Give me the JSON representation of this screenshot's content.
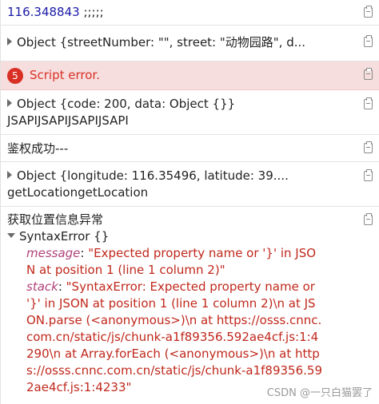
{
  "rows": {
    "r1": {
      "value": "116.348843",
      "suffix": " ;;;;;"
    },
    "r2": {
      "text": "Object {streetNumber: \"\", street: \"动物园路\", d..."
    },
    "r3": {
      "badge": "5",
      "text": "Script error."
    },
    "r4": {
      "line1": "Object {code: 200, data: Object {}}",
      "line2": "JSAPIJSAPIJSAPIJSAPI"
    },
    "r5": {
      "text": "鉴权成功---"
    },
    "r6": {
      "line1": "Object {longitude: 116.35496, latitude: 39....",
      "line2": "getLocationgetLocation"
    },
    "r7": {
      "title": "获取位置信息异常",
      "object_label": "SyntaxError {}",
      "message_key": "message",
      "message_value": "\"Expected property name or '}' in JSON at position 1 (line 1 column 2)\"",
      "stack_key": "stack",
      "stack_value": "\"SyntaxError: Expected property name or '}' in JSON at position 1 (line 1 column 2)\\n at JSON.parse (<anonymous>)\\n at https://osss.cnnc.com.cn/static/js/chunk-a1f89356.592ae4cf.js:1:4290\\n at Array.forEach (<anonymous>)\\n at https://osss.cnnc.com.cn/static/js/chunk-a1f89356.592ae4cf.js:1:4233\""
    }
  },
  "watermark": "CSDN @一只白猫罢了"
}
